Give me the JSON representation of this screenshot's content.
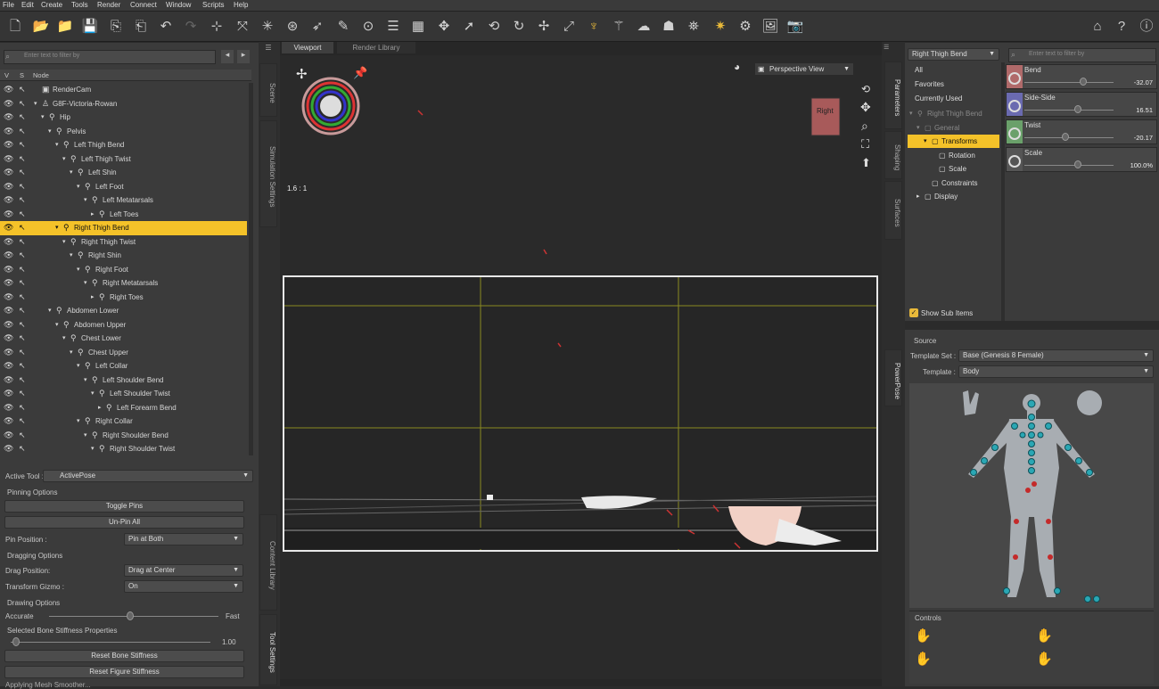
{
  "menu": [
    "File",
    "Edit",
    "Create",
    "Tools",
    "Render",
    "Connect",
    "Window",
    "Scripts",
    "Help"
  ],
  "scene": {
    "filter_placeholder": "Enter text to filter by",
    "col_v": "V",
    "col_s": "S",
    "col_node": "Node",
    "nodes": [
      "RenderCam",
      "G8F-Victoria-Rowan",
      "Hip",
      "Pelvis",
      "Left Thigh Bend",
      "Left Thigh Twist",
      "Left Shin",
      "Left Foot",
      "Left Metatarsals",
      "Left Toes",
      "Right Thigh Bend",
      "Right Thigh Twist",
      "Right Shin",
      "Right Foot",
      "Right Metatarsals",
      "Right Toes",
      "Abdomen Lower",
      "Abdomen Upper",
      "Chest Lower",
      "Chest Upper",
      "Left Collar",
      "Left Shoulder Bend",
      "Left Shoulder Twist",
      "Left Forearm Bend",
      "Right Collar",
      "Right Shoulder Bend",
      "Right Shoulder Twist"
    ],
    "selected": "Right Thigh Bend"
  },
  "side_tabs_left": [
    "Scene",
    "Simulation Settings",
    "Tool Settings",
    "Content Library"
  ],
  "tool": {
    "active_tool_label": "Active Tool :",
    "active_tool": "ActivePose",
    "pinning": "Pinning Options",
    "toggle_pins": "Toggle Pins",
    "unpin_all": "Un-Pin All",
    "pin_position_label": "Pin Position :",
    "pin_position": "Pin at Both",
    "dragging": "Dragging Options",
    "drag_position_label": "Drag Position:",
    "drag_position": "Drag at Center",
    "gizmo_label": "Transform Gizmo :",
    "gizmo": "On",
    "drawing": "Drawing Options",
    "accurate": "Accurate",
    "fast": "Fast",
    "stiffness": "Selected Bone Stiffness Properties",
    "stiffness_value": "1.00",
    "reset_bone": "Reset Bone Stiffness",
    "reset_figure": "Reset Figure Stiffness",
    "status": "Applying Mesh Smoother..."
  },
  "viewport": {
    "tab1": "Viewport",
    "tab2": "Render Library",
    "view": "Perspective View",
    "ratio": "1.6 : 1",
    "cube": "Right"
  },
  "params": {
    "node": "Right Thigh Bend",
    "filter_placeholder": "Enter text to filter by",
    "list": [
      "All",
      "Favorites",
      "Currently Used"
    ],
    "tree": [
      "Right Thigh Bend",
      "General",
      "Transforms",
      "Rotation",
      "Scale",
      "Constraints",
      "Display"
    ],
    "show_sub": "Show Sub Items",
    "tabs": [
      "Parameters",
      "Shaping",
      "Surfaces"
    ],
    "sliders": [
      {
        "name": "Bend",
        "value": "-32.07",
        "color": "#b06a6a"
      },
      {
        "name": "Side-Side",
        "value": "16.51",
        "color": "#6a6ab0"
      },
      {
        "name": "Twist",
        "value": "-20.17",
        "color": "#6aa06a"
      },
      {
        "name": "Scale",
        "value": "100.0%",
        "color": "#555555"
      }
    ]
  },
  "powerpose": {
    "tab": "PowerPose",
    "source": "Source",
    "template_set_label": "Template Set :",
    "template_set": "Base (Genesis 8 Female)",
    "template_label": "Template :",
    "template": "Body",
    "controls": "Controls"
  }
}
